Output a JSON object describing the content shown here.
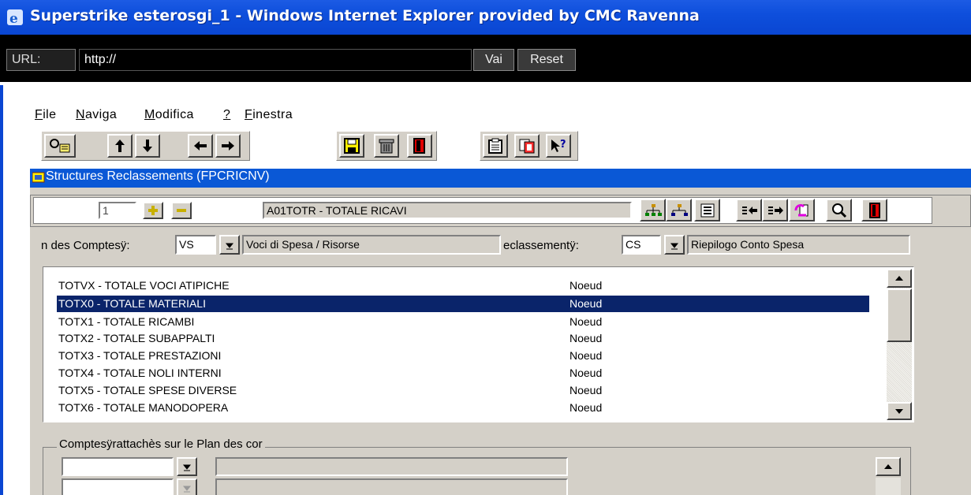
{
  "window": {
    "title": "Superstrike esterosgi_1 - Windows Internet Explorer provided by CMC Ravenna"
  },
  "urlbar": {
    "label": "URL:",
    "value": "http://",
    "go_label": "Vai",
    "reset_label": "Reset"
  },
  "menu": [
    {
      "key": "F",
      "rest": "ile"
    },
    {
      "key": "N",
      "rest": "aviga"
    },
    {
      "key": "M",
      "rest": "odifica"
    },
    {
      "key": "?",
      "rest": ""
    },
    {
      "key": "F",
      "rest": "inestra"
    }
  ],
  "form": {
    "title": "Structures Reclassements (FPCRICNV)",
    "record_number": "1",
    "record_value": "A01TOTR - TOTALE RICAVI",
    "plan_label": "n des Comptesÿ:",
    "plan_code": "VS",
    "plan_desc": "Voci di Spesa / Risorse",
    "reclass_label": "eclassementÿ:",
    "reclass_code": "CS",
    "reclass_desc": "Riepilogo Conto Spesa",
    "list": [
      {
        "name": "TOTVX - TOTALE VOCI ATIPICHE",
        "type": "Noeud"
      },
      {
        "name": "TOTX0 - TOTALE MATERIALI",
        "type": "Noeud",
        "selected": true
      },
      {
        "name": "TOTX1 - TOTALE RICAMBI",
        "type": "Noeud"
      },
      {
        "name": "TOTX2 - TOTALE SUBAPPALTI",
        "type": "Noeud"
      },
      {
        "name": "TOTX3 - TOTALE PRESTAZIONI",
        "type": "Noeud"
      },
      {
        "name": "TOTX4 - TOTALE NOLI INTERNI",
        "type": "Noeud"
      },
      {
        "name": "TOTX5 - TOTALE SPESE DIVERSE",
        "type": "Noeud"
      },
      {
        "name": "TOTX6 - TOTALE MANODOPERA",
        "type": "Noeud"
      }
    ],
    "group_label": "Comptesÿrattachès sur le Plan des cor"
  },
  "colors": {
    "titlebar": "#0a46d2",
    "selection": "#0a246a",
    "form_bg": "#d4d0c8"
  }
}
